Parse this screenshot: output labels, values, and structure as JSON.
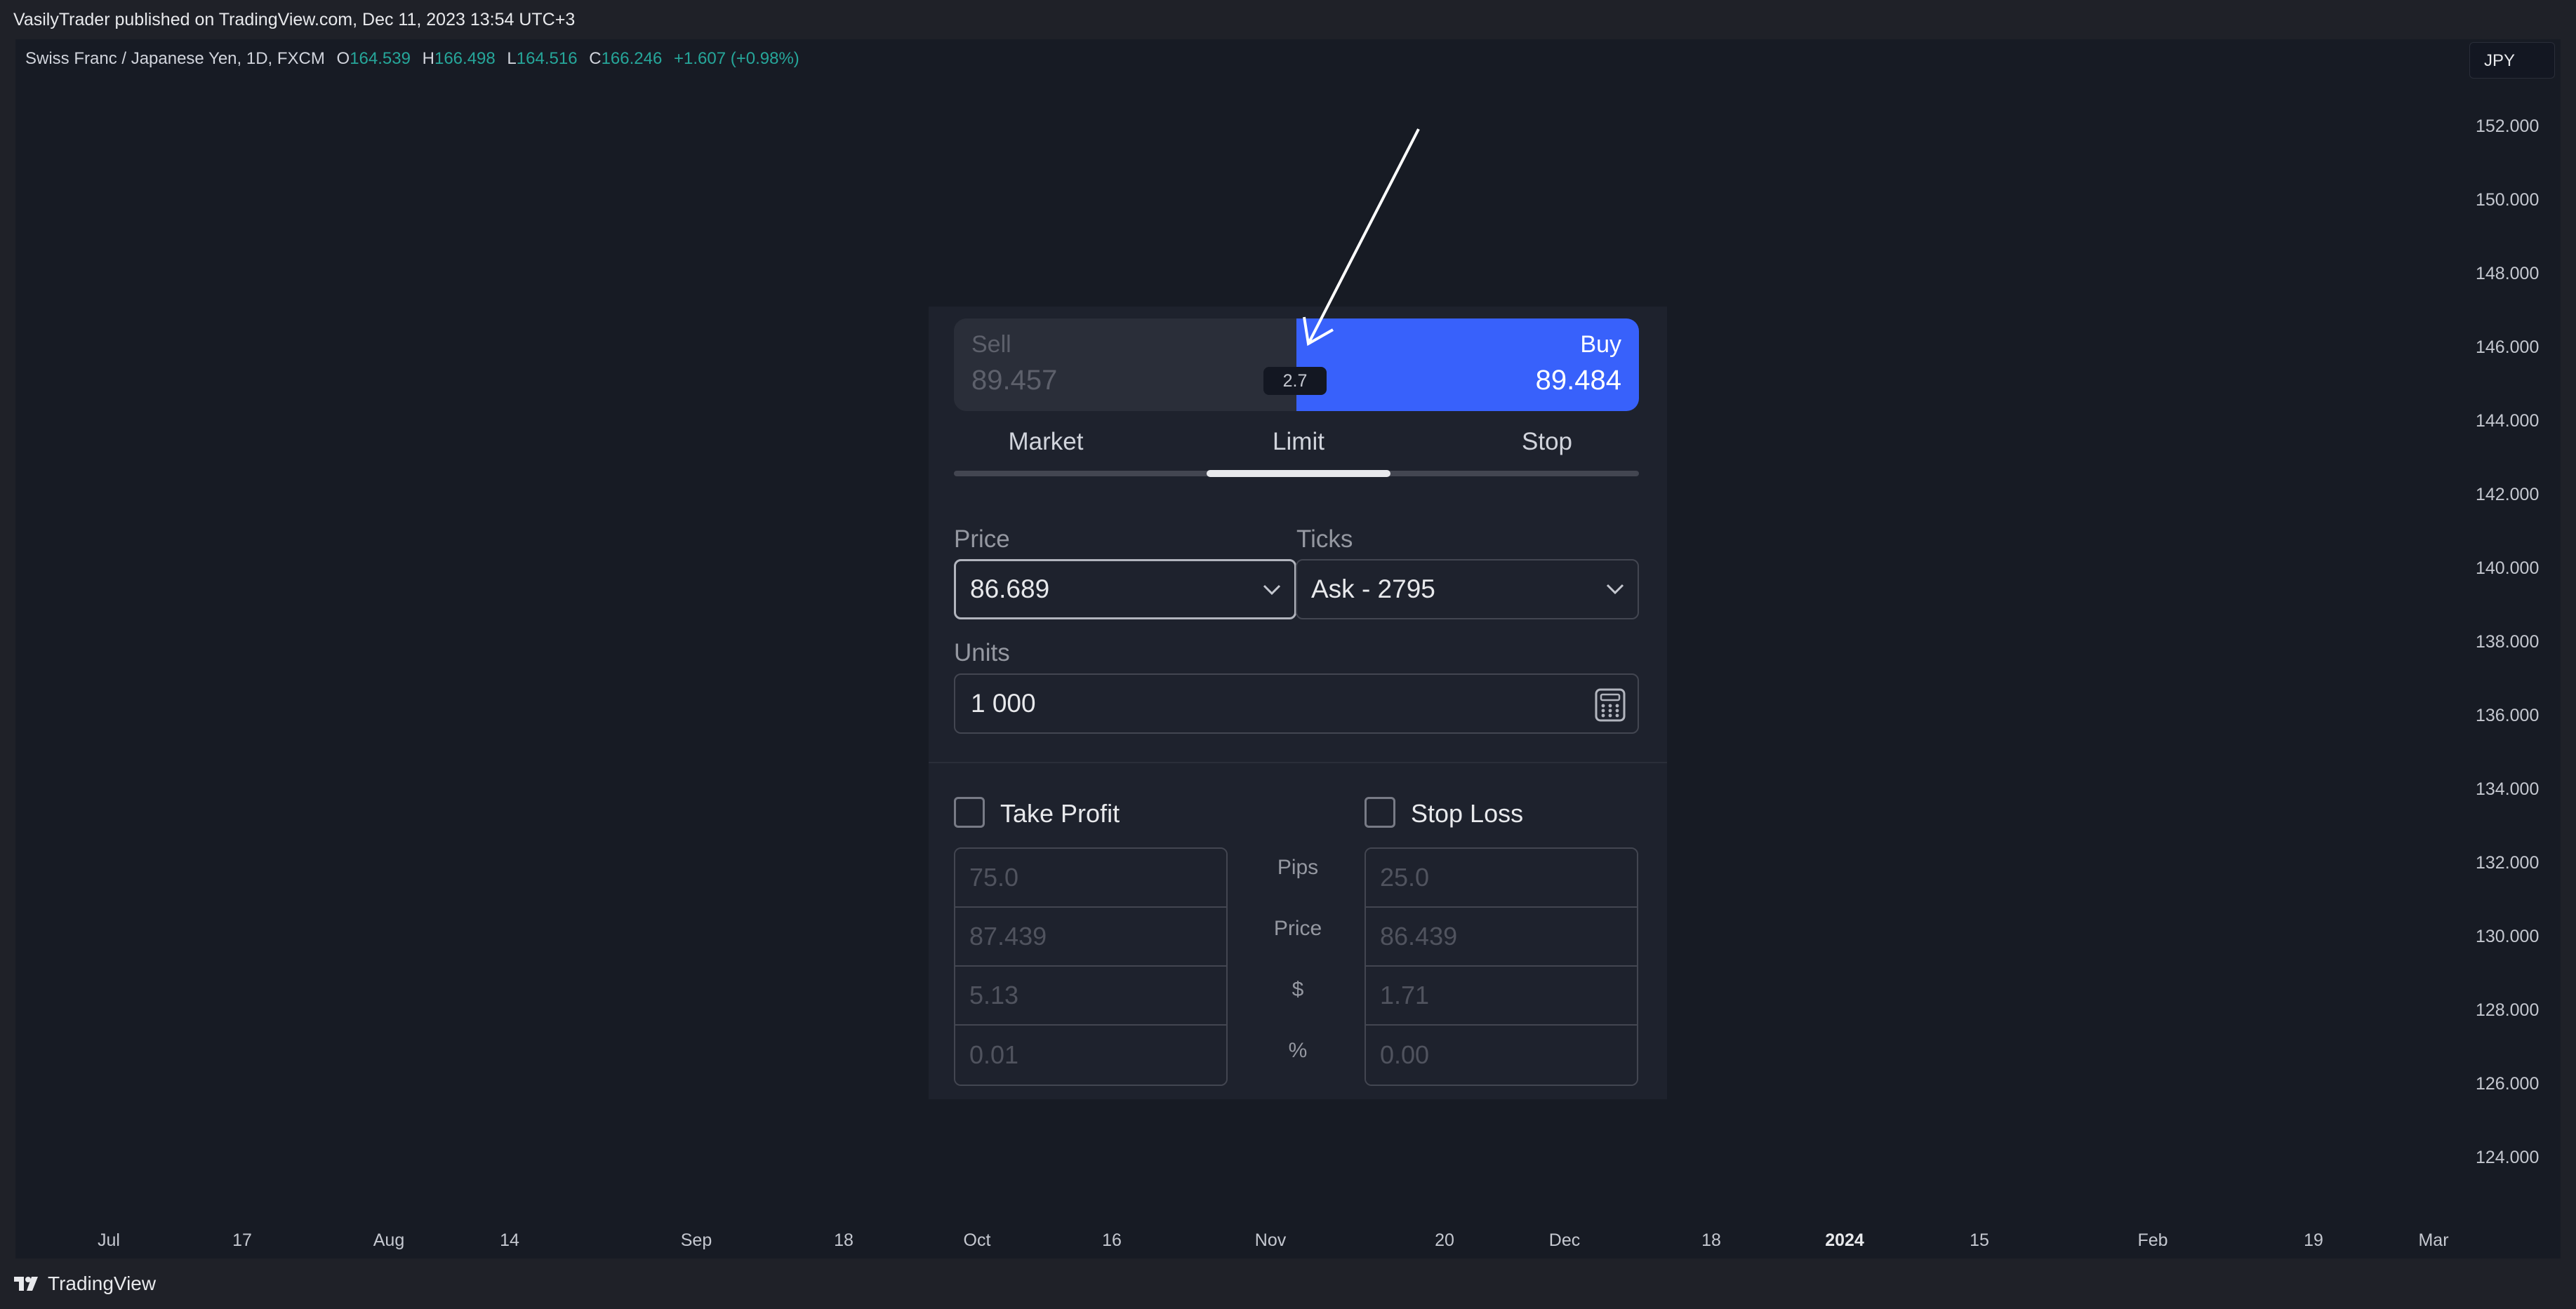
{
  "publish_info": "VasilyTrader published on TradingView.com, Dec 11, 2023 13:54 UTC+3",
  "symbol": {
    "name": "Swiss Franc / Japanese Yen, 1D, FXCM",
    "open_label": "O",
    "open": "164.539",
    "high_label": "H",
    "high": "166.498",
    "low_label": "L",
    "low": "164.516",
    "close_label": "C",
    "close": "166.246",
    "change": "+1.607 (+0.98%)"
  },
  "currency": "JPY",
  "y_axis": [
    "152.000",
    "150.000",
    "148.000",
    "146.000",
    "144.000",
    "142.000",
    "140.000",
    "138.000",
    "136.000",
    "134.000",
    "132.000",
    "130.000",
    "128.000",
    "126.000",
    "124.000"
  ],
  "x_axis": [
    "Jul",
    "17",
    "Aug",
    "14",
    "Sep",
    "18",
    "Oct",
    "16",
    "Nov",
    "20",
    "Dec",
    "18",
    "2024",
    "15",
    "Feb",
    "19",
    "Mar"
  ],
  "order_panel": {
    "sell": {
      "label": "Sell",
      "price": "89.457"
    },
    "buy": {
      "label": "Buy",
      "price": "89.484"
    },
    "spread": "2.7",
    "tabs": [
      "Market",
      "Limit",
      "Stop"
    ],
    "active_tab": "Limit",
    "price_label": "Price",
    "price_value": "86.689",
    "ticks_label": "Ticks",
    "ticks_value": "Ask - 2795",
    "units_label": "Units",
    "units_value": "1 000",
    "take_profit": {
      "label": "Take Profit",
      "checked": false,
      "pips": "75.0",
      "price": "87.439",
      "usd": "5.13",
      "pct": "0.01"
    },
    "stop_loss": {
      "label": "Stop Loss",
      "checked": false,
      "pips": "25.0",
      "price": "86.439",
      "usd": "1.71",
      "pct": "0.00"
    },
    "row_labels": [
      "Pips",
      "Price",
      "$",
      "%"
    ]
  },
  "brand": "TradingView",
  "colors": {
    "buy": "#3861fb",
    "up": "#26a69a",
    "background": "#171b24"
  }
}
